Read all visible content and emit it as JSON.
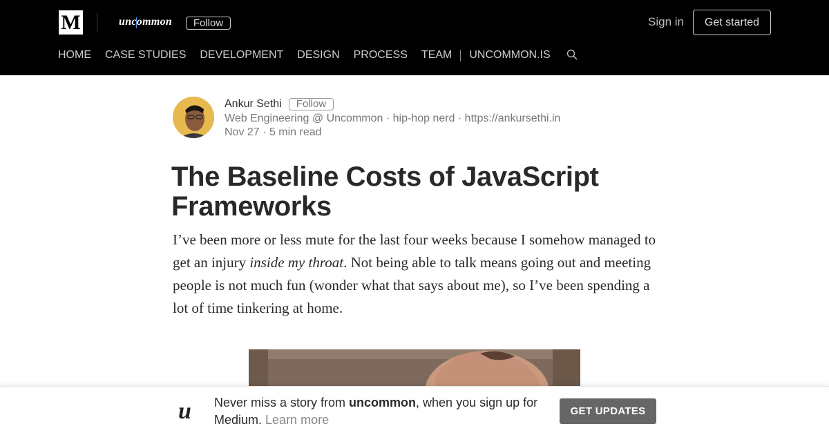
{
  "header": {
    "brand_logo": "M",
    "publication_logo": "uncommon",
    "follow_label": "Follow",
    "sign_in_label": "Sign in",
    "get_started_label": "Get started",
    "nav": [
      {
        "label": "HOME"
      },
      {
        "label": "CASE STUDIES"
      },
      {
        "label": "DEVELOPMENT"
      },
      {
        "label": "DESIGN"
      },
      {
        "label": "PROCESS"
      },
      {
        "label": "TEAM"
      },
      {
        "label": "UNCOMMON.IS"
      }
    ],
    "search_icon": "search-icon",
    "background": "#000000"
  },
  "author": {
    "name": "Ankur Sethi",
    "follow_label": "Follow",
    "bio": "Web Engineering @ Uncommon · hip-hop nerd · https://ankursethi.in",
    "date": "Nov 27",
    "read_time": "5 min read"
  },
  "article": {
    "title": "The Baseline Costs of JavaScript Frameworks",
    "intro_before": "I’ve been more or less mute for the last four weeks because I somehow managed to get an injury ",
    "intro_emphasis": "inside my throat",
    "intro_after": ". Not being able to talk means going out and meeting people is not much fun (wonder what that says about me), so I’ve been spending a lot of time tinkering at home."
  },
  "banner": {
    "logo": "u",
    "text_before": "Never miss a story from ",
    "publication": "uncommon",
    "text_after": ", when you sign up for Medium. ",
    "learn_more": "Learn more",
    "cta_label": "GET UPDATES",
    "cta_color": "#666666"
  }
}
